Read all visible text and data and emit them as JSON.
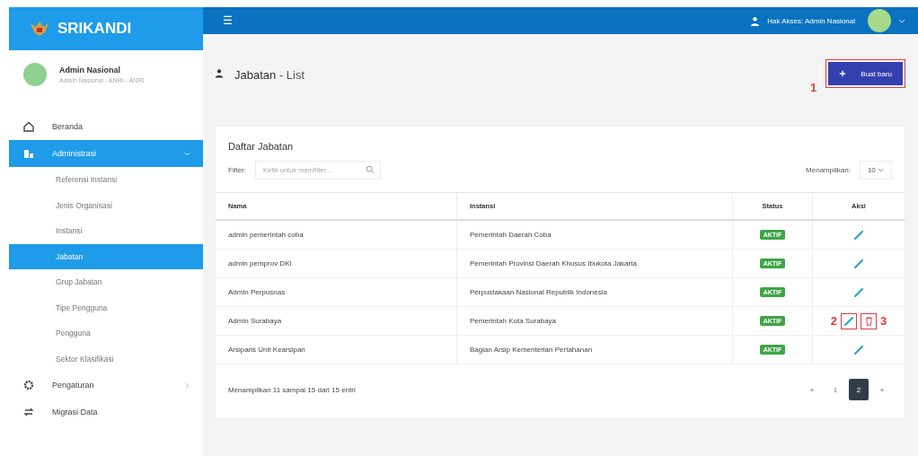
{
  "brand": {
    "name": "SRIKANDI"
  },
  "profile": {
    "name": "Admin Nasional",
    "subtitle": "Admin Nasional - ANRI - ANRI"
  },
  "sidebar": {
    "items": [
      {
        "label": "Beranda",
        "selected": false
      },
      {
        "label": "Administrasi",
        "selected": true,
        "expanded": true,
        "children": [
          {
            "label": "Referensi Instansi",
            "selected": false
          },
          {
            "label": "Jenis Organisasi",
            "selected": false
          },
          {
            "label": "Instansi",
            "selected": false
          },
          {
            "label": "Jabatan",
            "selected": true
          },
          {
            "label": "Grup Jabatan",
            "selected": false
          },
          {
            "label": "Tipe Pengguna",
            "selected": false
          },
          {
            "label": "Pengguna",
            "selected": false
          },
          {
            "label": "Sektor Klasifikasi",
            "selected": false
          }
        ]
      },
      {
        "label": "Pengaturan",
        "selected": false,
        "expanded": false
      },
      {
        "label": "Migrasi Data",
        "selected": false
      }
    ]
  },
  "topbar": {
    "menu_glyph": "☰",
    "access": "Hak Akses: Admin Nasional"
  },
  "page": {
    "title": "Jabatan",
    "subtitle": "- List",
    "new_button": "Buat baru",
    "annotation": "1"
  },
  "card": {
    "title": "Daftar Jabatan",
    "filter_label": "Filter:",
    "filter_placeholder": "Ketik untuk memfilter...",
    "show_label": "Menampilkan:",
    "page_size": "10"
  },
  "table": {
    "columns": [
      "Nama",
      "Instansi",
      "Status",
      "Aksi"
    ],
    "rows": [
      {
        "nama": "admin pemerintah coba",
        "instansi": "Pemerintah Daerah Coba",
        "status": "AKTIF",
        "deletable": false
      },
      {
        "nama": "admin pemprov DKI",
        "instansi": "Pemerintah Provinsi Daerah Khusus Ibukota Jakarta",
        "status": "AKTIF",
        "deletable": false
      },
      {
        "nama": "Admin Perpusnas",
        "instansi": "Perpustakaan Nasional Republik Indonesia",
        "status": "AKTIF",
        "deletable": false
      },
      {
        "nama": "Admin Surabaya",
        "instansi": "Pemerintah Kota Surabaya",
        "status": "AKTIF",
        "deletable": true,
        "edit_annotation": "2",
        "delete_annotation": "3"
      },
      {
        "nama": "Arsiparis Unit Kearsipan",
        "instansi": "Bagian Arsip Kementerian Pertahanan",
        "status": "AKTIF",
        "deletable": false
      }
    ]
  },
  "footer": {
    "info": "Menampilkan 11 sampai 15 dari 15 entri",
    "pages": [
      {
        "label": "«",
        "selected": false
      },
      {
        "label": "1",
        "selected": false
      },
      {
        "label": "2",
        "selected": true
      },
      {
        "label": "»",
        "selected": false
      }
    ]
  }
}
